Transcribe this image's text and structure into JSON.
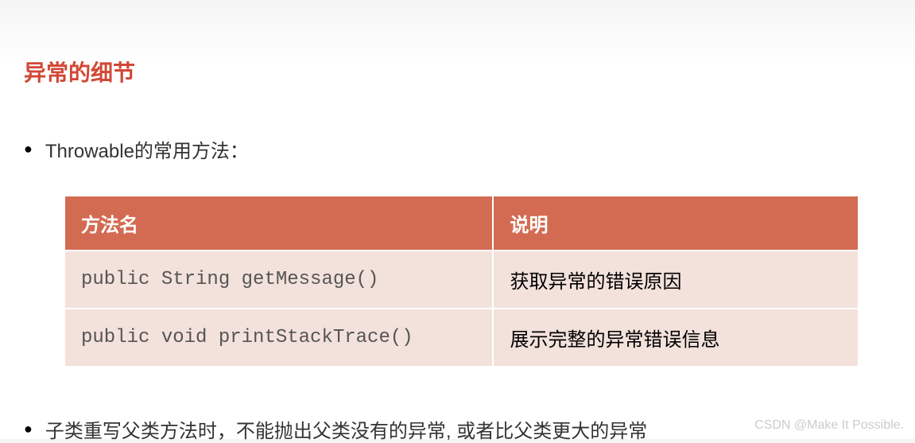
{
  "heading": "异常的细节",
  "bullet1": "Throwable的常用方法：",
  "bullet2": "子类重写父类方法时，不能抛出父类没有的异常, 或者比父类更大的异常",
  "table": {
    "header": {
      "col1": "方法名",
      "col2": "说明"
    },
    "rows": [
      {
        "method": "public String getMessage()",
        "desc": "获取异常的错误原因"
      },
      {
        "method": "public void printStackTrace()",
        "desc": "展示完整的异常错误信息"
      }
    ]
  },
  "watermark": "CSDN @Make It Possible."
}
